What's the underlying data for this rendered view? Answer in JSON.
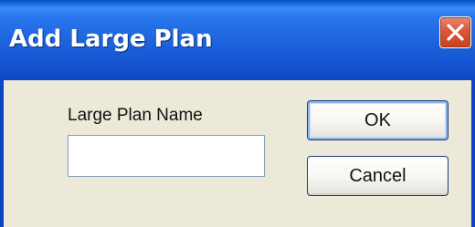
{
  "dialog": {
    "title": "Add Large Plan",
    "field_label": "Large Plan Name",
    "field_value": "",
    "ok_label": "OK",
    "cancel_label": "Cancel"
  },
  "icons": {
    "close": "close-icon"
  },
  "colors": {
    "titlebar": "#1e67df",
    "close_button": "#d9573c",
    "dialog_background": "#ece9d8"
  }
}
